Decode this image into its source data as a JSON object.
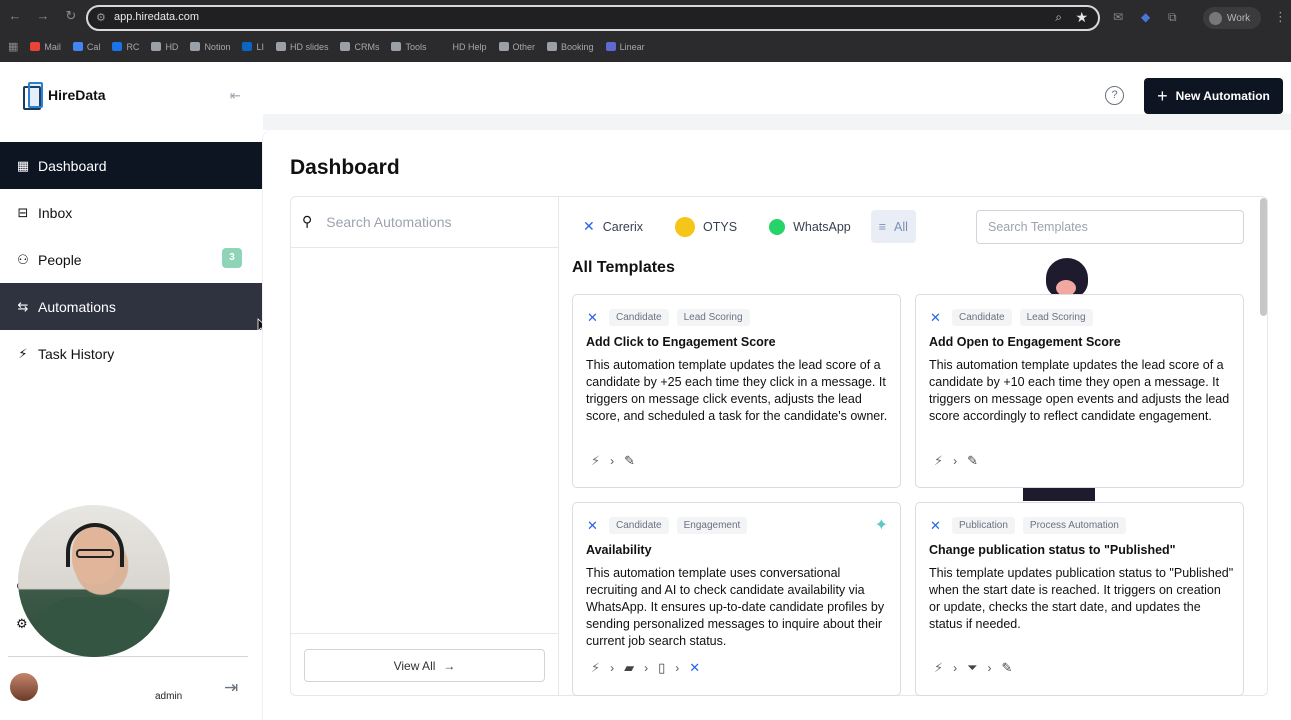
{
  "browser": {
    "url": "app.hiredata.com",
    "profile": "Work",
    "bookmarks": [
      {
        "label": "Mail",
        "color": "#ea4335"
      },
      {
        "label": "Cal",
        "color": "#4285f4"
      },
      {
        "label": "RC",
        "color": "#1a73e8"
      },
      {
        "label": "HD",
        "color": "#9aa0a6"
      },
      {
        "label": "Notion",
        "color": "#9aa0a6"
      },
      {
        "label": "LI",
        "color": "#0a66c2"
      },
      {
        "label": "HD slides",
        "color": "#9aa0a6"
      },
      {
        "label": "CRMs",
        "color": "#9aa0a6"
      },
      {
        "label": "Tools",
        "color": "#9aa0a6"
      },
      {
        "label": "HD Help",
        "color": "#2b2b2d"
      },
      {
        "label": "Other",
        "color": "#9aa0a6"
      },
      {
        "label": "Booking",
        "color": "#9aa0a6"
      },
      {
        "label": "Linear",
        "color": "#5e6ad2"
      }
    ]
  },
  "app": {
    "name": "HireData"
  },
  "sidebar": {
    "items": [
      {
        "label": "Dashboard",
        "icon": "grid-icon",
        "glyph": "▦"
      },
      {
        "label": "Inbox",
        "icon": "inbox-icon",
        "glyph": "⊟"
      },
      {
        "label": "People",
        "icon": "people-icon",
        "glyph": "⚇",
        "badge": "3"
      },
      {
        "label": "Automations",
        "icon": "repeat-icon",
        "glyph": "⇆"
      },
      {
        "label": "Task History",
        "icon": "lightning-icon",
        "glyph": "⚡"
      }
    ],
    "lower_items": [
      {
        "label": "S",
        "glyph": "⊗"
      },
      {
        "label": "",
        "glyph": "⚙"
      }
    ],
    "user_role": "admin"
  },
  "header": {
    "new_automation_label": "New Automation",
    "help_glyph": "?"
  },
  "main": {
    "title": "Dashboard",
    "search_automations_placeholder": "Search Automations",
    "view_all_label": "View All",
    "tabs": [
      {
        "label": "Carerix"
      },
      {
        "label": "OTYS"
      },
      {
        "label": "WhatsApp"
      },
      {
        "label": "All"
      }
    ],
    "search_templates_placeholder": "Search Templates",
    "section_title": "All Templates",
    "cards": [
      {
        "tags": [
          "Candidate",
          "Lead Scoring"
        ],
        "title": "Add Click to Engagement Score",
        "description": "This automation template updates the lead score of a candidate by +25 each time they click in a message. It triggers on message click events, adjusts the lead score, and scheduled a task for the candidate's owner."
      },
      {
        "tags": [
          "Candidate",
          "Lead Scoring"
        ],
        "title": "Add Open to Engagement Score",
        "description": "This automation template updates the lead score of a candidate by +10 each time they open a message. It triggers on message open events and adjusts the lead score accordingly to reflect candidate engagement."
      },
      {
        "tags": [
          "Candidate",
          "Engagement"
        ],
        "title": "Availability",
        "description": "This automation template uses conversational recruiting and AI to check candidate availability via WhatsApp. It ensures up-to-date candidate profiles by sending personalized messages to inquire about their current job search status."
      },
      {
        "tags": [
          "Publication",
          "Process Automation"
        ],
        "title": "Change publication status to \"Published\"",
        "description": "This template updates publication status to \"Published\" when the start date is reached. It triggers on creation or update, checks the start date, and updates the status if needed."
      }
    ]
  }
}
